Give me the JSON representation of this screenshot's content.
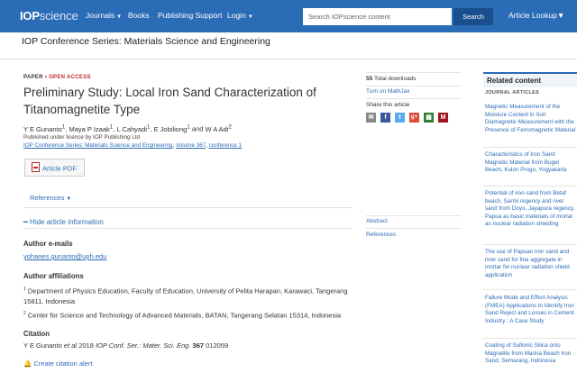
{
  "header": {
    "logo_iop": "IOP",
    "logo_science": "science",
    "nav": [
      {
        "label": "Journals",
        "dropdown": true
      },
      {
        "label": "Books",
        "dropdown": false
      },
      {
        "label": "Publishing Support",
        "dropdown": false
      },
      {
        "label": "Login",
        "dropdown": true
      }
    ],
    "search_placeholder": "Search IOPscience content",
    "search_button": "Search",
    "article_lookup": "Article Lookup"
  },
  "journal_title": "IOP Conference Series: Materials Science and Engineering",
  "article": {
    "kicker_paper": "PAPER",
    "kicker_sep": " • ",
    "kicker_open_access": "OPEN ACCESS",
    "title": "Preliminary Study: Local Iron Sand Characterization of Titanomagnetite Type",
    "authors": [
      {
        "name": "Y E Gunanto",
        "aff": "1"
      },
      {
        "name": "Maya P Izaak",
        "aff": "1"
      },
      {
        "name": "L Cahyadi",
        "aff": "1"
      },
      {
        "name": "E Jobiliong",
        "aff": "1"
      },
      {
        "name": "W A Adi",
        "aff": "2"
      }
    ],
    "author_and": "and",
    "licence": "Published under licence by IOP Publishing Ltd",
    "breadcrumb": {
      "journal": "IOP Conference Series: Materials Science and Engineering",
      "volume": "Volume 367",
      "conference": "conference 1"
    },
    "pdf_label": "Article PDF",
    "references_label": "References",
    "hide_info": "Hide article information",
    "emails_heading": "Author e-mails",
    "email": "yohanes.gunanto@uph.edu",
    "affiliations_heading": "Author affiliations",
    "affiliations": [
      {
        "num": "1",
        "text": "Department of Physics Education, Faculty of Education, University of Pelita Harapan, Karawaci, Tangerang 15811, Indonesia"
      },
      {
        "num": "2",
        "text": "Center for Science and Technology of Advanced Materials, BATAN, Tangerang Selatan 15314, Indonesia"
      }
    ],
    "citation_heading": "Citation",
    "citation": {
      "authors": "Y E Gunanto",
      "etal": "et al",
      "year": "2018",
      "journal": "IOP Conf. Ser.: Mater. Sci. Eng.",
      "volume": "367",
      "page": "012059"
    },
    "citation_alert": "Create citation alert"
  },
  "metrics": {
    "downloads_count": "55",
    "downloads_label": "Total downloads",
    "mathjax": "Turn on MathJax",
    "share_label": "Share this article",
    "share_icons": [
      {
        "name": "email-icon",
        "glyph": "✉",
        "color": "#888888"
      },
      {
        "name": "facebook-icon",
        "glyph": "f",
        "color": "#3b5998"
      },
      {
        "name": "twitter-icon",
        "glyph": "t",
        "color": "#55acee"
      },
      {
        "name": "googleplus-icon",
        "glyph": "g+",
        "color": "#dd4b39"
      },
      {
        "name": "citeulike-icon",
        "glyph": "▦",
        "color": "#2e7d32"
      },
      {
        "name": "mendeley-icon",
        "glyph": "M",
        "color": "#9d1620"
      }
    ],
    "abstract_link": "Abstract",
    "references_link": "References"
  },
  "related": {
    "heading": "Related content",
    "subheading": "JOURNAL ARTICLES",
    "items": [
      "Magnetic Measurement of the Moisture Content in Soil: Diamagnetic Measurement with the Presence of Ferromagnetic Material",
      "Characteristics of Iron Sand Magnetic Material from Bugel Beach, Kulon Progo, Yogyakarta",
      "Potential of iron sand from Betaf beach, Sarmi regency and river sand from Doyo, Jayapura regency, Papua as basic materials of mortar as nuclear radiation shielding",
      "The use of Papuan iron sand and river sand for fine aggregate in mortar for nuclear radiation shield application",
      "Failure Mode and Effect Analysis (FMEA) Applications to Identify Iron Sand Reject and Losses in Cement Industry : A Case Study",
      "Coating of Sulfonic Silica onto Magnetite from Marina Beach Iron Sand, Semarang, Indonesia"
    ]
  }
}
